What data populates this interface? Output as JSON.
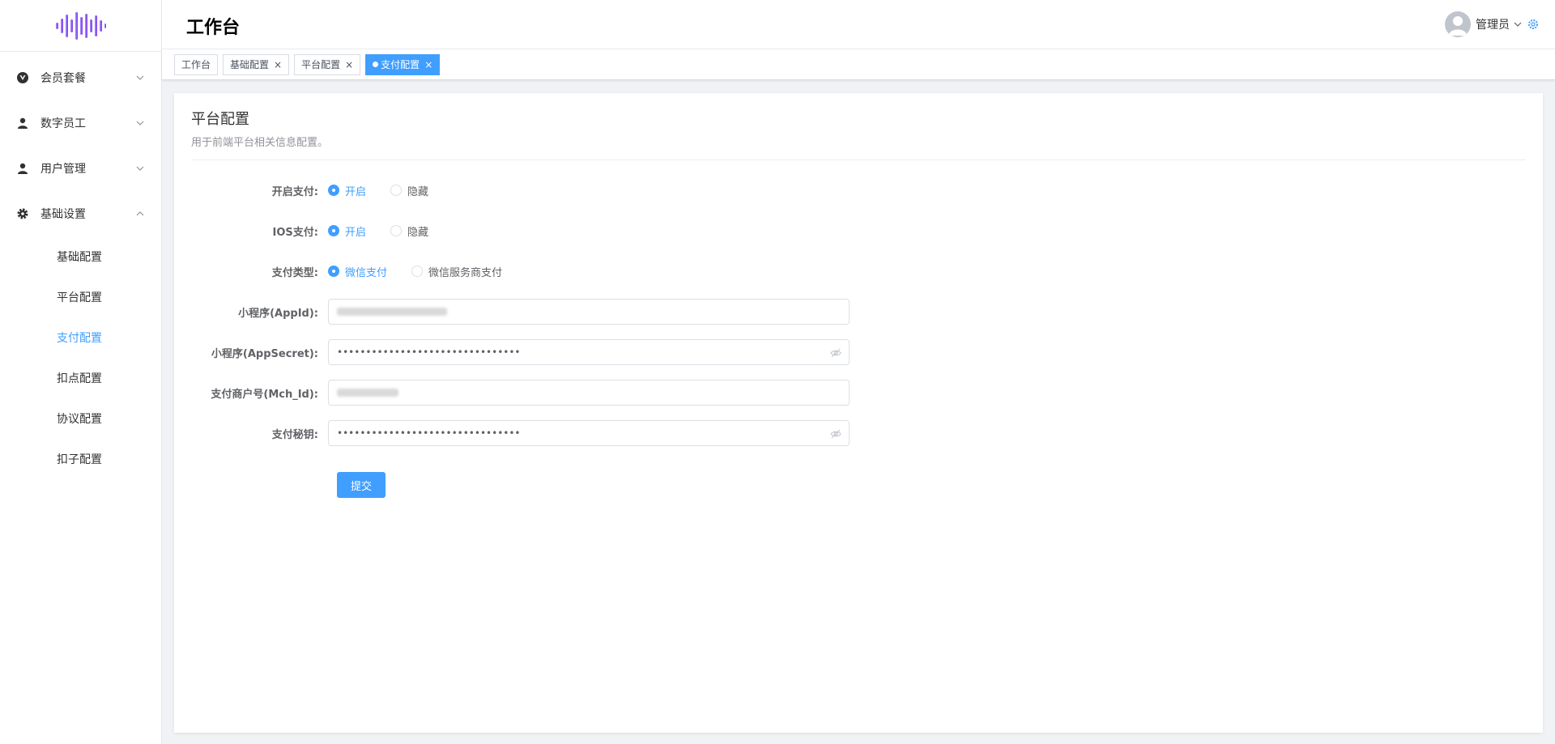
{
  "sidebar": {
    "items": [
      {
        "label": "会员套餐"
      },
      {
        "label": "数字员工"
      },
      {
        "label": "用户管理"
      },
      {
        "label": "基础设置"
      }
    ],
    "submenu": [
      {
        "label": "基础配置"
      },
      {
        "label": "平台配置"
      },
      {
        "label": "支付配置"
      },
      {
        "label": "扣点配置"
      },
      {
        "label": "协议配置"
      },
      {
        "label": "扣子配置"
      }
    ],
    "active_submenu": "支付配置"
  },
  "header": {
    "title": "工作台",
    "user": "管理员"
  },
  "tags": [
    {
      "label": "工作台"
    },
    {
      "label": "基础配置"
    },
    {
      "label": "平台配置"
    },
    {
      "label": "支付配置"
    }
  ],
  "card": {
    "title": "平台配置",
    "subtitle": "用于前端平台相关信息配置。"
  },
  "form": {
    "pay_enable": {
      "label": "开启支付:",
      "options": [
        "开启",
        "隐藏"
      ],
      "selected": "开启"
    },
    "ios_pay": {
      "label": "IOS支付:",
      "options": [
        "开启",
        "隐藏"
      ],
      "selected": "开启"
    },
    "pay_type": {
      "label": "支付类型:",
      "options": [
        "微信支付",
        "微信服务商支付"
      ],
      "selected": "微信支付"
    },
    "appid": {
      "label": "小程序(AppId):"
    },
    "appsecret": {
      "label": "小程序(AppSecret):",
      "value": "••••••••••••••••••••••••••••••••"
    },
    "mch_id": {
      "label": "支付商户号(Mch_Id):"
    },
    "pay_secret": {
      "label": "支付秘钥:",
      "value": "••••••••••••••••••••••••••••••••"
    },
    "submit": "提交"
  },
  "colors": {
    "accent": "#409eff",
    "logo": "#8b5cf6"
  }
}
